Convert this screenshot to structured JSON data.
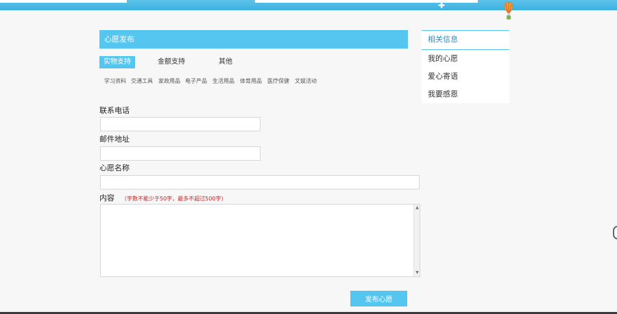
{
  "panel": {
    "title": "心愿发布"
  },
  "type_tabs": [
    {
      "label": "实物支持",
      "active": true
    },
    {
      "label": "金额支持",
      "active": false
    },
    {
      "label": "other",
      "active": false
    }
  ],
  "type_tab_third": "其他",
  "categories": [
    "学习资料",
    "交通工具",
    "家政用品",
    "电子产品",
    "生活用品",
    "体育用品",
    "医疗保健",
    "文娱活动"
  ],
  "form": {
    "phone_label": "联系电话",
    "phone_value": "",
    "email_label": "邮件地址",
    "email_value": "",
    "wish_name_label": "心愿名称",
    "wish_name_value": "",
    "content_label": "内容",
    "content_hint": "（字数不能少于50字，最多不超过500字）",
    "content_value": ""
  },
  "submit_label": "发布心愿",
  "side": {
    "title": "相关信息",
    "links": [
      "我的心愿",
      "爱心寄语",
      "我要感恩"
    ]
  },
  "colors": {
    "accent": "#55c6ef",
    "hint": "#cc2222"
  }
}
